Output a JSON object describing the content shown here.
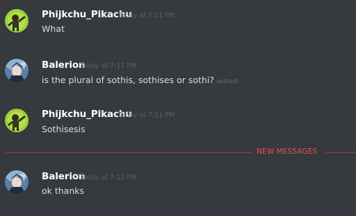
{
  "messages": [
    {
      "username": "Phijkchu_Pikachu",
      "timestamp": "Today at 7:11 PM",
      "text": "What",
      "edited": "",
      "avatar_icon": "pikachu-dab-avatar"
    },
    {
      "username": "Balerion",
      "timestamp": "Today at 7:11 PM",
      "text": "is the plural of sothis, sothises or sothi?",
      "edited": "(edited)",
      "avatar_icon": "balerion-anime-avatar"
    },
    {
      "username": "Phijkchu_Pikachu",
      "timestamp": "Today at 7:11 PM",
      "text": "Sothisesis",
      "edited": "",
      "avatar_icon": "pikachu-dab-avatar"
    },
    {
      "username": "Balerion",
      "timestamp": "Today at 7:12 PM",
      "text": "ok thanks",
      "edited": "",
      "avatar_icon": "balerion-anime-avatar"
    }
  ],
  "new_messages_label": "NEW MESSAGES",
  "colors": {
    "background": "#36393e",
    "username": "#ffffff",
    "message_text": "#dcddde",
    "timestamp": "#5d6066",
    "new_messages_accent": "#e2535a",
    "avatar_pikachu_bg": "#9bd13c",
    "avatar_balerion_bg": "#5a7fa8"
  }
}
